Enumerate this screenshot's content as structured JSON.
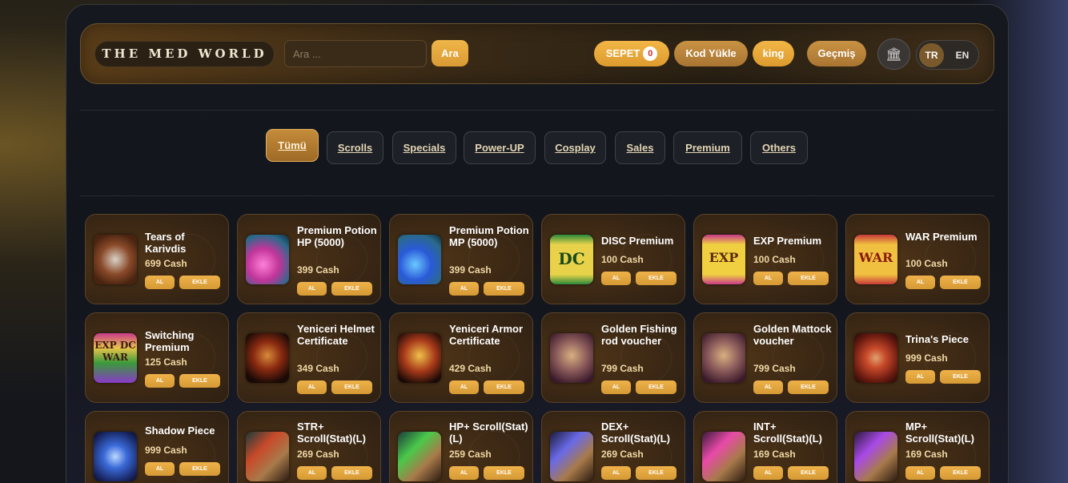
{
  "header": {
    "logo": "THE MED WORLD",
    "search_placeholder": "Ara ...",
    "search_button": "Ara",
    "cart_label": "SEPET",
    "cart_count": "0",
    "code_button": "Kod Yükle",
    "user_button": "king",
    "history_button": "Geçmiş",
    "bank_icon": "🏛",
    "lang_tr": "TR",
    "lang_en": "EN"
  },
  "tabs": [
    "Tümü",
    "Scrolls",
    "Specials",
    "Power-UP",
    "Cosplay",
    "Sales",
    "Premium",
    "Others"
  ],
  "active_tab": "Tümü",
  "buy_label": "AL",
  "add_label": "EKLE",
  "products": [
    {
      "name": "Tears of Karivdis",
      "price": "699 Cash",
      "icon": "tears-icon"
    },
    {
      "name": "Premium Potion HP (5000)",
      "price": "399 Cash",
      "icon": "potion-hp-icon"
    },
    {
      "name": "Premium Potion MP (5000)",
      "price": "399 Cash",
      "icon": "potion-mp-icon"
    },
    {
      "name": "DISC Premium",
      "price": "100 Cash",
      "icon": "disc-premium-icon",
      "thumb_text": "DC"
    },
    {
      "name": "EXP Premium",
      "price": "100 Cash",
      "icon": "exp-premium-icon",
      "thumb_text": "EXP"
    },
    {
      "name": "WAR Premium",
      "price": "100 Cash",
      "icon": "war-premium-icon",
      "thumb_text": "WAR"
    },
    {
      "name": "Switching Premium",
      "price": "125 Cash",
      "icon": "switching-premium-icon",
      "thumb_text": "EXP DC WAR"
    },
    {
      "name": "Yeniceri Helmet Certificate",
      "price": "349 Cash",
      "icon": "helmet-icon"
    },
    {
      "name": "Yeniceri Armor Certificate",
      "price": "429 Cash",
      "icon": "armor-icon"
    },
    {
      "name": "Golden Fishing rod voucher",
      "price": "799 Cash",
      "icon": "fishing-rod-icon"
    },
    {
      "name": "Golden Mattock voucher",
      "price": "799 Cash",
      "icon": "mattock-icon"
    },
    {
      "name": "Trina's Piece",
      "price": "999 Cash",
      "icon": "trina-piece-icon"
    },
    {
      "name": "Shadow Piece",
      "price": "999 Cash",
      "icon": "shadow-piece-icon"
    },
    {
      "name": "STR+ Scroll(Stat)(L)",
      "price": "269 Cash",
      "icon": "str-scroll-icon"
    },
    {
      "name": "HP+ Scroll(Stat)(L)",
      "price": "259 Cash",
      "icon": "hp-scroll-icon"
    },
    {
      "name": "DEX+ Scroll(Stat)(L)",
      "price": "269 Cash",
      "icon": "dex-scroll-icon"
    },
    {
      "name": "INT+ Scroll(Stat)(L)",
      "price": "169 Cash",
      "icon": "int-scroll-icon"
    },
    {
      "name": "MP+ Scroll(Stat)(L)",
      "price": "169 Cash",
      "icon": "mp-scroll-icon"
    }
  ],
  "colors": {
    "accent": "#e9a93f",
    "card_bg": "#3a2714",
    "tab_active": "#b07a30"
  }
}
